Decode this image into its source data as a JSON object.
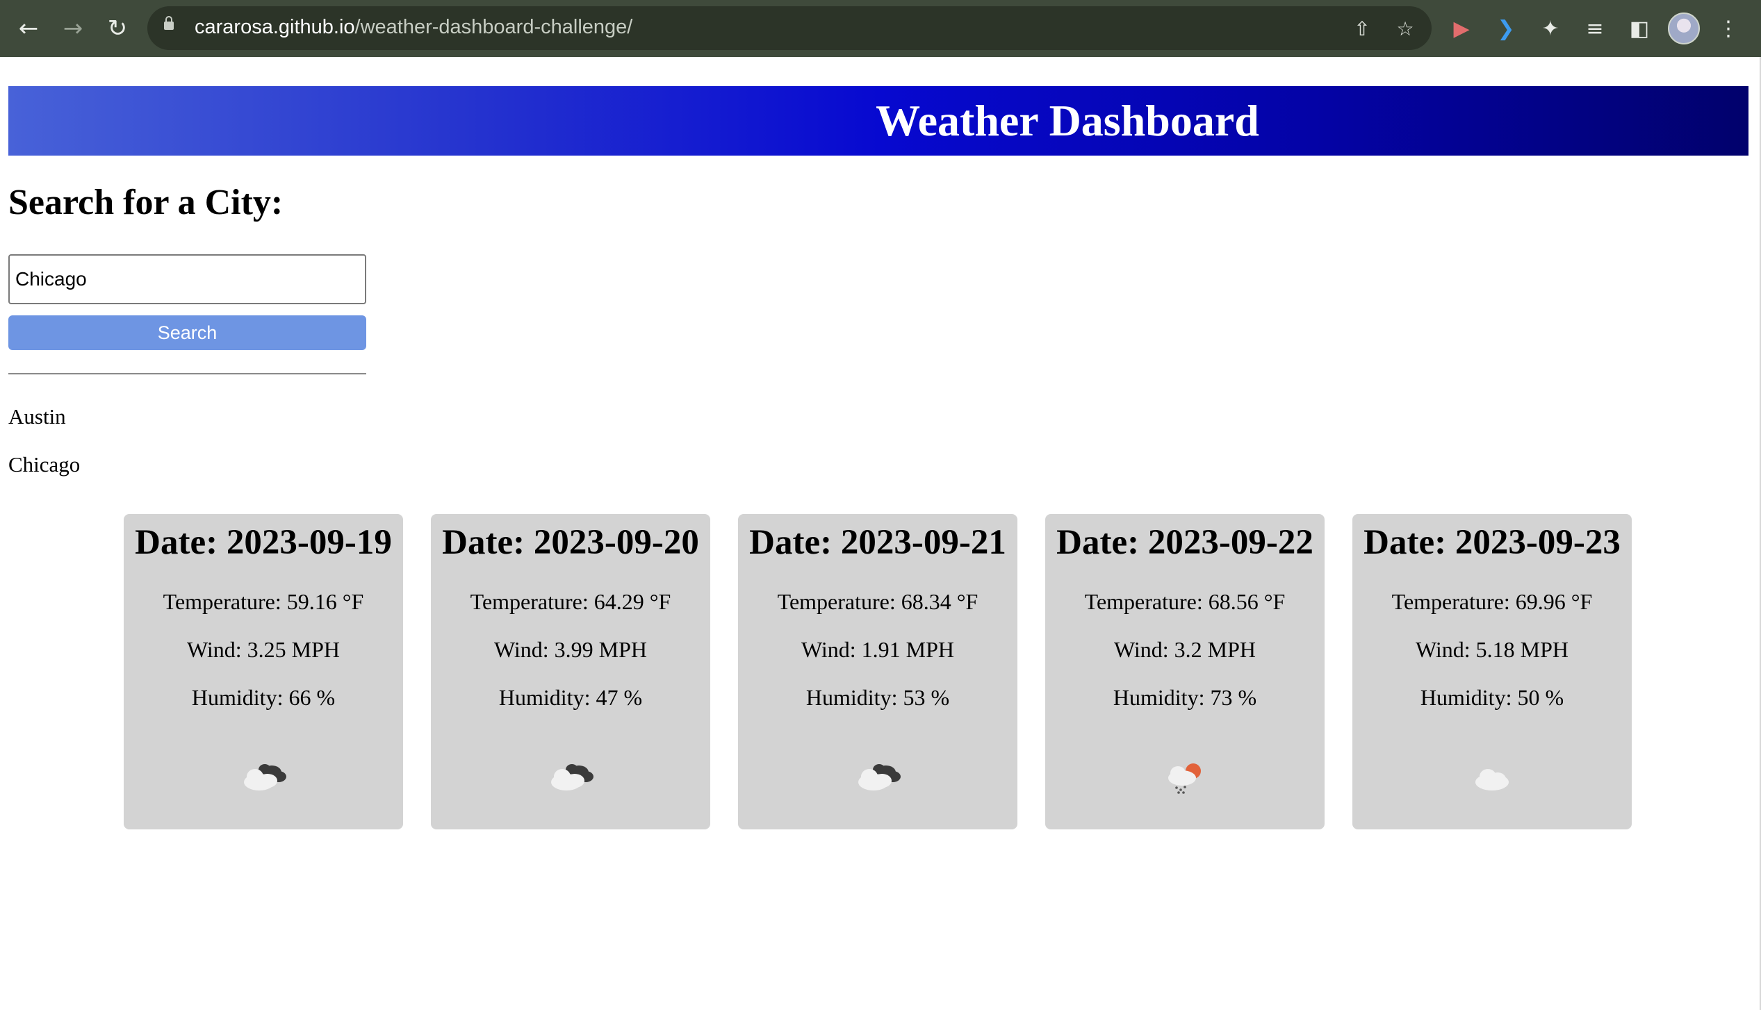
{
  "browser": {
    "url_host": "cararosa.github.io",
    "url_path": "/weather-dashboard-challenge/"
  },
  "page": {
    "title": "Weather Dashboard",
    "search_heading": "Search for a City:",
    "search_input_value": "Chicago",
    "search_button": "Search",
    "history": [
      "Austin",
      "Chicago"
    ]
  },
  "forecast": [
    {
      "date": "Date: 2023-09-19",
      "temperature": "Temperature: 59.16 °F",
      "wind": "Wind: 3.25 MPH",
      "humidity": "Humidity: 66 %",
      "icon": "broken-clouds-icon"
    },
    {
      "date": "Date: 2023-09-20",
      "temperature": "Temperature: 64.29 °F",
      "wind": "Wind: 3.99 MPH",
      "humidity": "Humidity: 47 %",
      "icon": "broken-clouds-icon"
    },
    {
      "date": "Date: 2023-09-21",
      "temperature": "Temperature: 68.34 °F",
      "wind": "Wind: 1.91 MPH",
      "humidity": "Humidity: 53 %",
      "icon": "broken-clouds-icon"
    },
    {
      "date": "Date: 2023-09-22",
      "temperature": "Temperature: 68.56 °F",
      "wind": "Wind: 3.2 MPH",
      "humidity": "Humidity: 73 %",
      "icon": "rain-sun-icon"
    },
    {
      "date": "Date: 2023-09-23",
      "temperature": "Temperature: 69.96 °F",
      "wind": "Wind: 5.18 MPH",
      "humidity": "Humidity: 50 %",
      "icon": "cloud-icon"
    }
  ]
}
